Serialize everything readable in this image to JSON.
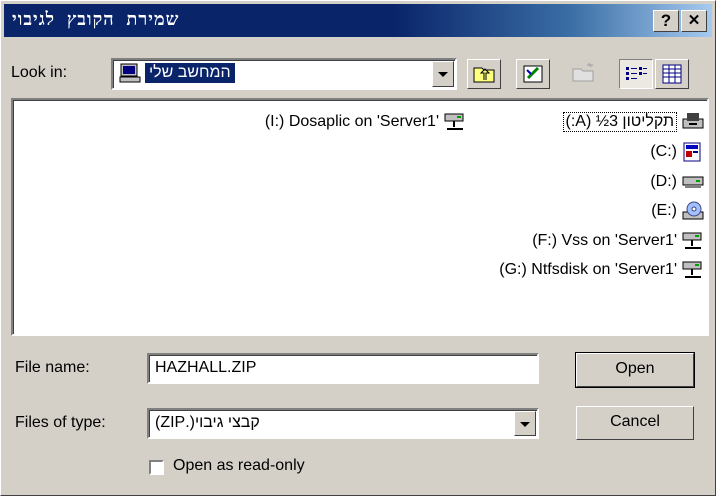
{
  "window": {
    "title": "שמירת הקובץ לגיבוי",
    "help_glyph": "?",
    "close_glyph": "✕"
  },
  "look_in": {
    "label": "Look in:",
    "value": "המחשב שלי"
  },
  "drives": [
    {
      "label": "(I:) Dosaplic on 'Server1'",
      "icon": "network-drive-icon"
    },
    {
      "label": "תקליטון 3½ (A:)",
      "icon": "floppy-drive-icon"
    },
    {
      "label": "(C:)",
      "icon": "hard-drive-icon"
    },
    {
      "label": "(D:)",
      "icon": "hard-drive-icon"
    },
    {
      "label": "(E:)",
      "icon": "cd-drive-icon"
    },
    {
      "label": "(F:) Vss on 'Server1'",
      "icon": "network-drive-icon"
    },
    {
      "label": "(G:) Ntfsdisk on 'Server1'",
      "icon": "network-drive-icon"
    }
  ],
  "file_name": {
    "label": "File name:",
    "value": "HAZHALL.ZIP"
  },
  "file_type": {
    "label": "Files of type:",
    "value": "קבצי גיבוי(.ZIP)"
  },
  "buttons": {
    "open": "Open",
    "cancel": "Cancel"
  },
  "read_only": {
    "label": "Open as read-only",
    "checked": false
  }
}
